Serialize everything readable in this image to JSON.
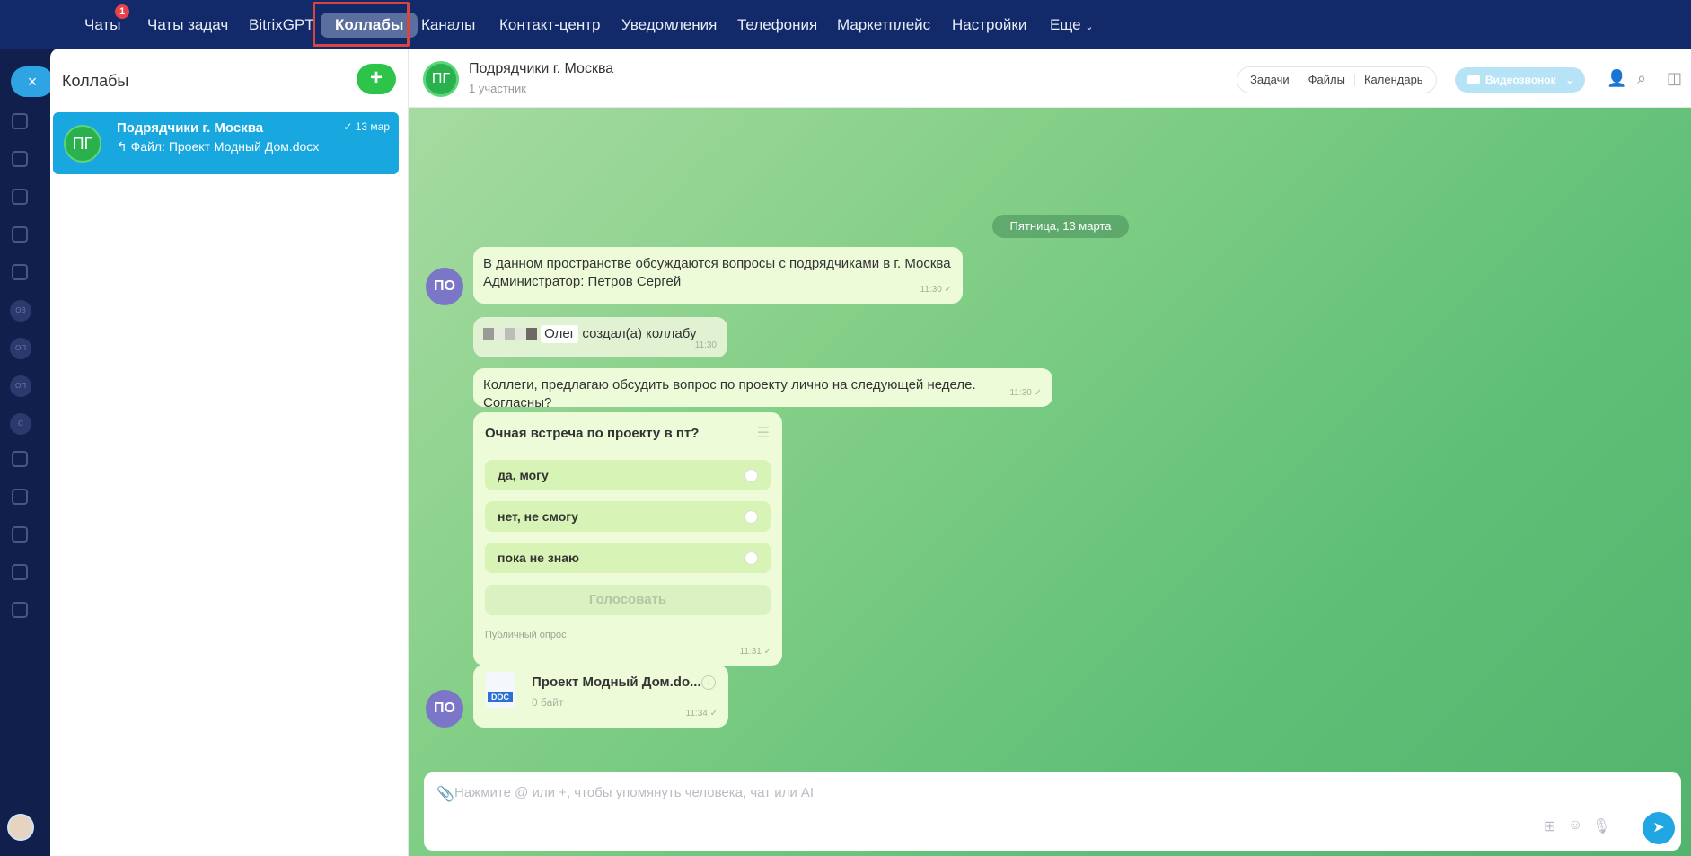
{
  "topnav": {
    "tabs": [
      "Чаты",
      "Чаты задач",
      "BitrixGPT",
      "Коллабы",
      "Каналы",
      "Контакт-центр",
      "Уведомления",
      "Телефония",
      "Маркетплейс",
      "Настройки",
      "Еще"
    ],
    "chats_badge": "1",
    "active_tab": "Коллабы"
  },
  "sidebar": {
    "close_label": "×",
    "circle_labels": [
      "ОВ",
      "ОП",
      "ОП",
      "С"
    ]
  },
  "list": {
    "title": "Коллабы",
    "add_label": "+",
    "items": [
      {
        "name": "Подрядчики г. Москва",
        "avatar": "ПГ",
        "last_message": "Файл: Проект Модный Дом.docx",
        "date": "13 мар"
      }
    ]
  },
  "chat": {
    "avatar": "ПГ",
    "title": "Подрядчики г. Москва",
    "subtitle": "1 участник",
    "header_tabs": [
      "Задачи",
      "Файлы",
      "Календарь"
    ],
    "video_label": "Видеозвонок",
    "date_separator": "Пятница, 13 марта",
    "messages": [
      {
        "avatar": "ПО",
        "line1": "В данном пространстве обсуждаются вопросы с подрядчиками в г. Москва",
        "line2": "Администратор: Петров Сергей",
        "time": "11:30"
      },
      {
        "name": "Олег",
        "text": "создал(а) коллабу",
        "time": "11:30"
      },
      {
        "text": "Коллеги, предлагаю обсудить вопрос по проекту лично на следующей неделе. Согласны?",
        "time": "11:30"
      }
    ],
    "poll": {
      "title": "Очная встреча по проекту в пт?",
      "options": [
        "да, могу",
        "нет, не смогу",
        "пока не знаю"
      ],
      "vote_label": "Голосовать",
      "note": "Публичный опрос",
      "time": "11:31"
    },
    "file": {
      "avatar": "ПО",
      "icon_label": "DOC",
      "name": "Проект Модный Дом.do...",
      "size": "0 байт",
      "time": "11:34"
    }
  },
  "composer": {
    "placeholder": "Нажмите @ или +, чтобы упомянуть человека, чат или AI"
  },
  "colors": {
    "nav_bg": "#132a6a",
    "accent_blue": "#19a7e0",
    "accent_green": "#2ec44a",
    "avatar_purple": "#7b76c8",
    "highlight_red": "#d8473f"
  }
}
